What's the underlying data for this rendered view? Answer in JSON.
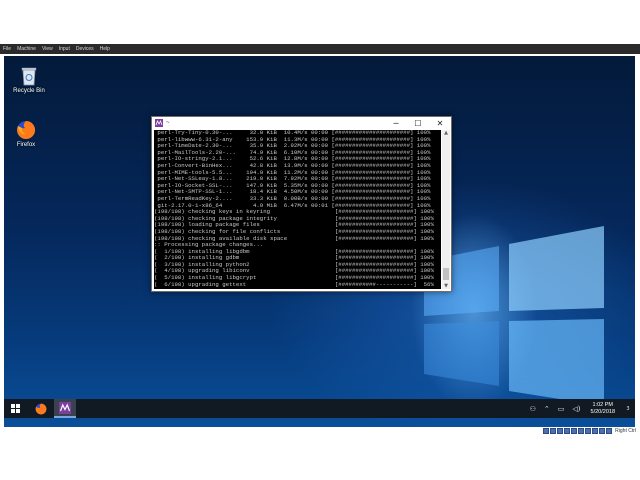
{
  "vm_menu": [
    "File",
    "Machine",
    "View",
    "Input",
    "Devices",
    "Help"
  ],
  "vm_status": {
    "host_key": "Right Ctrl"
  },
  "desktop_icons": [
    {
      "label": "Recycle Bin",
      "icon": "recycle-bin-icon"
    },
    {
      "label": "Firefox",
      "icon": "firefox-icon"
    }
  ],
  "terminal": {
    "title": "~",
    "lines": [
      " perl-Try-Tiny-0.30-...     32.0 KiB  10.4M/s 00:00 [######################] 100%",
      " perl-libwww-6.31-2-any    153.9 KiB  11.3M/s 00:00 [######################] 100%",
      " perl-TimeDate-2.30-...     35.9 KiB  2.92M/s 00:00 [######################] 100%",
      " perl-MailTools-2.20-...    74.9 KiB  6.10M/s 00:00 [######################] 100%",
      " perl-IO-stringy-2.1...     52.6 KiB  12.8M/s 00:00 [######################] 100%",
      " perl-Convert-BinHex...     42.8 KiB  13.9M/s 00:00 [######################] 100%",
      " perl-MIME-tools-5.5...    194.9 KiB  11.2M/s 00:00 [######################] 100%",
      " perl-Net-SSLeay-1.8...    219.0 KiB  7.92M/s 00:00 [######################] 100%",
      " perl-IO-Socket-SSL-...    147.9 KiB  5.35M/s 00:00 [######################] 100%",
      " perl-Net-SMTP-SSL-1...     18.4 KiB  4.50M/s 00:00 [######################] 100%",
      " perl-TermReadKey-2....     33.3 KiB  0.00B/s 00:00 [######################] 100%",
      " git-2.17.0-1-x86_64         4.9 MiB  6.47M/s 00:01 [######################] 100%",
      "(198/198) checking keys in keyring                   [######################] 100%",
      "(198/198) checking package integrity                 [######################] 100%",
      "(198/198) loading package files                      [######################] 100%",
      "(198/198) checking for file conflicts                [######################] 100%",
      "(198/198) checking available disk space              [######################] 100%",
      ":: Processing package changes...",
      "(  1/198) installing libgdbm                         [######################] 100%",
      "(  2/198) installing gdbm                            [######################] 100%",
      "(  3/198) installing python2                         [######################] 100%",
      "(  4/198) upgrading libiconv                         [######################] 100%",
      "(  5/198) installing libgcrypt                       [######################] 100%",
      "(  6/198) upgrading gettext                          [###########-----------]  56%"
    ],
    "minimize": "─",
    "maximize": "☐",
    "close": "✕"
  },
  "taskbar": {
    "apps": [
      "windows-start-icon",
      "firefox-icon",
      "msys2-terminal-icon"
    ],
    "time": "1:02 PM",
    "date": "5/20/2018",
    "notification_count": "3"
  },
  "colors": {
    "terminal_bg": "#000000",
    "terminal_fg": "#c8c8c8",
    "taskbar_bg": "#111a22",
    "desktop_blue": "#0a4f9a"
  }
}
